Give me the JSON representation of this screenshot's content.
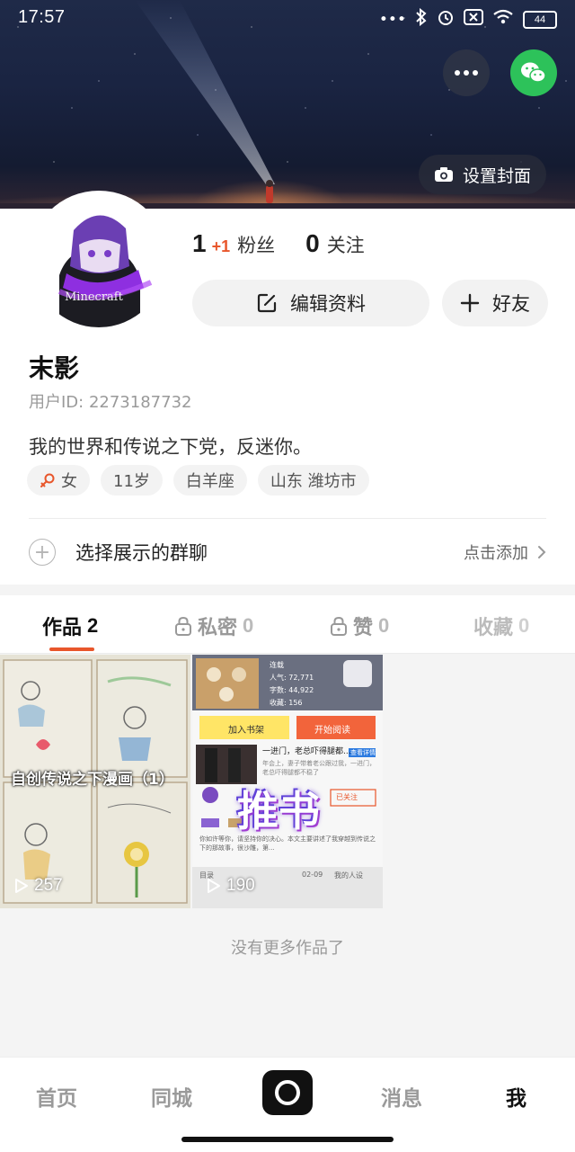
{
  "status_bar": {
    "time": "17:57",
    "battery": "44",
    "icons": [
      "more-dots-icon",
      "bluetooth-icon",
      "alarm-icon",
      "sim-off-icon",
      "wifi-icon",
      "battery-icon"
    ]
  },
  "header": {
    "set_cover_label": "设置封面",
    "buttons": [
      "more-icon",
      "wechat-icon"
    ]
  },
  "profile": {
    "fans_count": "1",
    "fans_increment": "+1",
    "fans_label": "粉丝",
    "following_count": "0",
    "following_label": "关注",
    "edit_profile_label": "编辑资料",
    "add_friend_label": "好友",
    "nickname": "末影",
    "user_id": "用户ID: 2273187732",
    "bio": "我的世界和传说之下党，反迷你。",
    "tags": [
      "女",
      "11岁",
      "白羊座",
      "山东 潍坊市"
    ],
    "avatar_text": "Minecraft"
  },
  "group_chat": {
    "label": "选择展示的群聊",
    "action": "点击添加"
  },
  "tabs": [
    {
      "label": "作品",
      "count": "2",
      "active": true
    },
    {
      "label": "私密",
      "count": "0",
      "active": false
    },
    {
      "label": "赞",
      "count": "0",
      "active": false
    },
    {
      "label": "收藏",
      "count": "0",
      "active": false
    }
  ],
  "works": [
    {
      "title": "自创传说之下漫画（1）",
      "views": "257"
    },
    {
      "overlay": "推书",
      "views": "190",
      "book_stats": [
        "连载",
        "人气: 72,771",
        "字数: 44,922",
        "收藏: 156"
      ],
      "book_buttons": [
        "加入书架",
        "开始阅读"
      ],
      "book_headline": "一进门，老总吓得腿都...",
      "book_detail_tag": "查看详情",
      "book_snippet": "年会上，妻子带着老公跟过我，一进门，老总吓得腿都不稳了",
      "follow_label": "已关注",
      "book_desc": "你如许等你，请坚持你的决心。本文主要讲述了我穿越到传说之下的那故事，很沙雕，第...",
      "toc_label": "目录",
      "toc_date": "02-09",
      "toc_author": "我的人设"
    }
  ],
  "no_more_label": "没有更多作品了",
  "bottom_nav": {
    "items": [
      "首页",
      "同城",
      "消息",
      "我"
    ],
    "active": "我"
  },
  "colors": {
    "accent": "#e8562b",
    "wechat": "#2dc25a"
  }
}
